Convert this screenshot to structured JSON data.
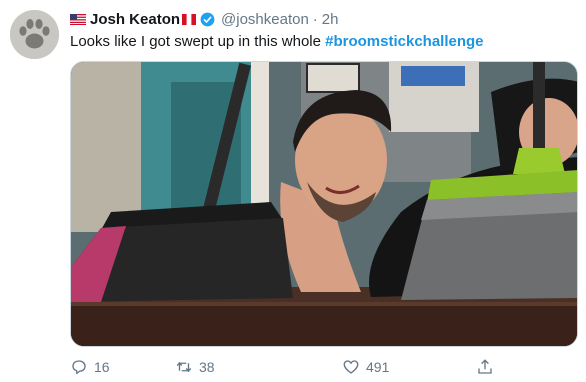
{
  "user": {
    "name": "Josh Keaton",
    "handle": "@joshkeaton",
    "separator": "·",
    "time": "2h",
    "verified": true
  },
  "tweet": {
    "text_before": "Looks like I got swept up in this whole ",
    "hashtag": "#broomstickchallenge"
  },
  "media": {
    "subject": "photo-man-lying-between-two-upright-brooms"
  },
  "actions": {
    "reply_count": "16",
    "retweet_count": "38",
    "like_count": "491"
  },
  "colors": {
    "accent": "#1b95e0",
    "verified_badge": "#1da1f2",
    "muted_text": "#657786",
    "primary_text": "#14171a"
  },
  "icons": [
    "us-flag-icon",
    "peru-flag-icon",
    "verified-badge-icon",
    "reply-icon",
    "retweet-icon",
    "like-icon",
    "share-icon"
  ]
}
